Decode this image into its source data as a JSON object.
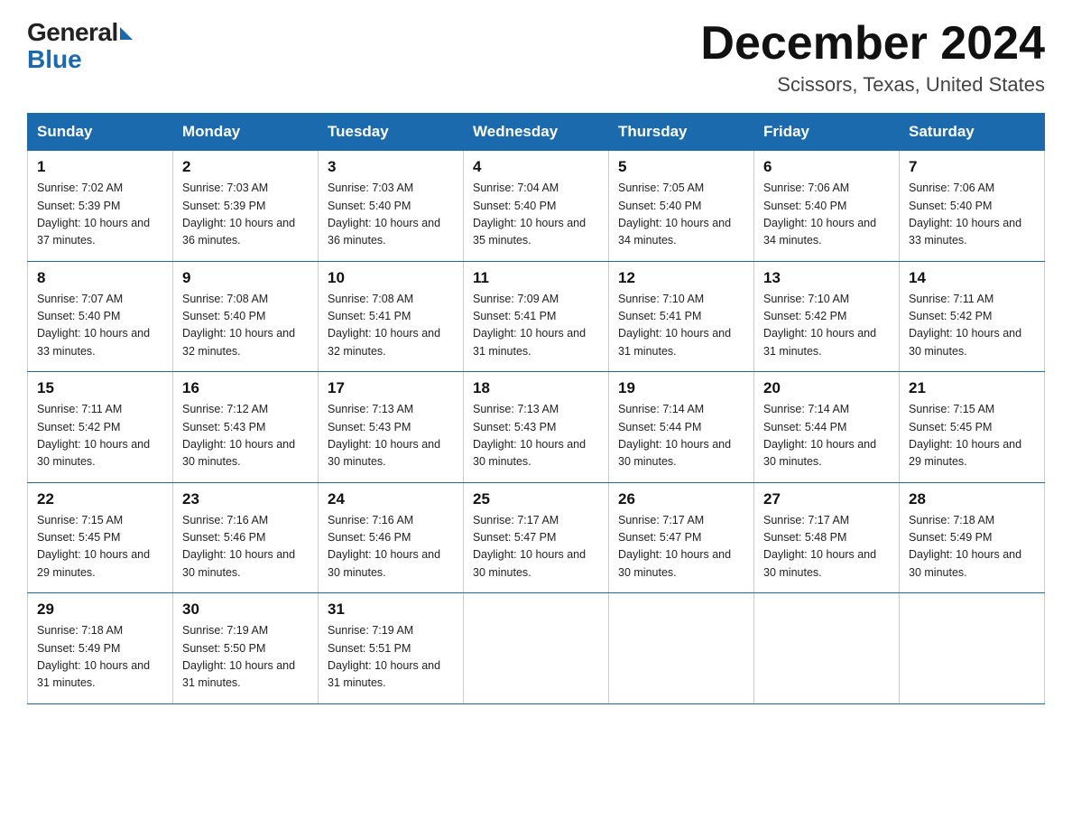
{
  "header": {
    "logo_general": "General",
    "logo_blue": "Blue",
    "month_title": "December 2024",
    "location": "Scissors, Texas, United States"
  },
  "days_of_week": [
    "Sunday",
    "Monday",
    "Tuesday",
    "Wednesday",
    "Thursday",
    "Friday",
    "Saturday"
  ],
  "weeks": [
    [
      {
        "day": "1",
        "sunrise": "7:02 AM",
        "sunset": "5:39 PM",
        "daylight": "10 hours and 37 minutes."
      },
      {
        "day": "2",
        "sunrise": "7:03 AM",
        "sunset": "5:39 PM",
        "daylight": "10 hours and 36 minutes."
      },
      {
        "day": "3",
        "sunrise": "7:03 AM",
        "sunset": "5:40 PM",
        "daylight": "10 hours and 36 minutes."
      },
      {
        "day": "4",
        "sunrise": "7:04 AM",
        "sunset": "5:40 PM",
        "daylight": "10 hours and 35 minutes."
      },
      {
        "day": "5",
        "sunrise": "7:05 AM",
        "sunset": "5:40 PM",
        "daylight": "10 hours and 34 minutes."
      },
      {
        "day": "6",
        "sunrise": "7:06 AM",
        "sunset": "5:40 PM",
        "daylight": "10 hours and 34 minutes."
      },
      {
        "day": "7",
        "sunrise": "7:06 AM",
        "sunset": "5:40 PM",
        "daylight": "10 hours and 33 minutes."
      }
    ],
    [
      {
        "day": "8",
        "sunrise": "7:07 AM",
        "sunset": "5:40 PM",
        "daylight": "10 hours and 33 minutes."
      },
      {
        "day": "9",
        "sunrise": "7:08 AM",
        "sunset": "5:40 PM",
        "daylight": "10 hours and 32 minutes."
      },
      {
        "day": "10",
        "sunrise": "7:08 AM",
        "sunset": "5:41 PM",
        "daylight": "10 hours and 32 minutes."
      },
      {
        "day": "11",
        "sunrise": "7:09 AM",
        "sunset": "5:41 PM",
        "daylight": "10 hours and 31 minutes."
      },
      {
        "day": "12",
        "sunrise": "7:10 AM",
        "sunset": "5:41 PM",
        "daylight": "10 hours and 31 minutes."
      },
      {
        "day": "13",
        "sunrise": "7:10 AM",
        "sunset": "5:42 PM",
        "daylight": "10 hours and 31 minutes."
      },
      {
        "day": "14",
        "sunrise": "7:11 AM",
        "sunset": "5:42 PM",
        "daylight": "10 hours and 30 minutes."
      }
    ],
    [
      {
        "day": "15",
        "sunrise": "7:11 AM",
        "sunset": "5:42 PM",
        "daylight": "10 hours and 30 minutes."
      },
      {
        "day": "16",
        "sunrise": "7:12 AM",
        "sunset": "5:43 PM",
        "daylight": "10 hours and 30 minutes."
      },
      {
        "day": "17",
        "sunrise": "7:13 AM",
        "sunset": "5:43 PM",
        "daylight": "10 hours and 30 minutes."
      },
      {
        "day": "18",
        "sunrise": "7:13 AM",
        "sunset": "5:43 PM",
        "daylight": "10 hours and 30 minutes."
      },
      {
        "day": "19",
        "sunrise": "7:14 AM",
        "sunset": "5:44 PM",
        "daylight": "10 hours and 30 minutes."
      },
      {
        "day": "20",
        "sunrise": "7:14 AM",
        "sunset": "5:44 PM",
        "daylight": "10 hours and 30 minutes."
      },
      {
        "day": "21",
        "sunrise": "7:15 AM",
        "sunset": "5:45 PM",
        "daylight": "10 hours and 29 minutes."
      }
    ],
    [
      {
        "day": "22",
        "sunrise": "7:15 AM",
        "sunset": "5:45 PM",
        "daylight": "10 hours and 29 minutes."
      },
      {
        "day": "23",
        "sunrise": "7:16 AM",
        "sunset": "5:46 PM",
        "daylight": "10 hours and 30 minutes."
      },
      {
        "day": "24",
        "sunrise": "7:16 AM",
        "sunset": "5:46 PM",
        "daylight": "10 hours and 30 minutes."
      },
      {
        "day": "25",
        "sunrise": "7:17 AM",
        "sunset": "5:47 PM",
        "daylight": "10 hours and 30 minutes."
      },
      {
        "day": "26",
        "sunrise": "7:17 AM",
        "sunset": "5:47 PM",
        "daylight": "10 hours and 30 minutes."
      },
      {
        "day": "27",
        "sunrise": "7:17 AM",
        "sunset": "5:48 PM",
        "daylight": "10 hours and 30 minutes."
      },
      {
        "day": "28",
        "sunrise": "7:18 AM",
        "sunset": "5:49 PM",
        "daylight": "10 hours and 30 minutes."
      }
    ],
    [
      {
        "day": "29",
        "sunrise": "7:18 AM",
        "sunset": "5:49 PM",
        "daylight": "10 hours and 31 minutes."
      },
      {
        "day": "30",
        "sunrise": "7:19 AM",
        "sunset": "5:50 PM",
        "daylight": "10 hours and 31 minutes."
      },
      {
        "day": "31",
        "sunrise": "7:19 AM",
        "sunset": "5:51 PM",
        "daylight": "10 hours and 31 minutes."
      },
      null,
      null,
      null,
      null
    ]
  ],
  "labels": {
    "sunrise_prefix": "Sunrise: ",
    "sunset_prefix": "Sunset: ",
    "daylight_prefix": "Daylight: "
  }
}
